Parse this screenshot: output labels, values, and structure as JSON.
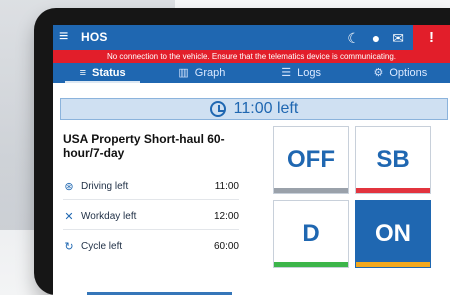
{
  "header": {
    "app_title": "HOS",
    "icons": [
      "menu-icon",
      "moon-icon",
      "user-icon",
      "mail-icon",
      "alert-icon"
    ],
    "alert_symbol": "!"
  },
  "warning": {
    "text": "No connection to the vehicle. Ensure that the telematics device is communicating."
  },
  "tabs": [
    {
      "label": "Status",
      "icon": "list-icon",
      "active": true
    },
    {
      "label": "Graph",
      "icon": "graph-icon",
      "active": false
    },
    {
      "label": "Logs",
      "icon": "logs-icon",
      "active": false
    },
    {
      "label": "Options",
      "icon": "options-icon",
      "active": false
    }
  ],
  "time_left": {
    "text": "11:00 left",
    "icon": "timer-icon"
  },
  "ruleset": {
    "title": "USA Property Short-haul 60-hour/7-day",
    "items": [
      {
        "label": "Driving left",
        "value": "11:00",
        "icon": "steering-wheel-icon"
      },
      {
        "label": "Workday left",
        "value": "12:00",
        "icon": "tools-icon"
      },
      {
        "label": "Cycle left",
        "value": "60:00",
        "icon": "cycle-icon"
      }
    ]
  },
  "status_buttons": [
    {
      "label": "OFF",
      "key": "off"
    },
    {
      "label": "SB",
      "key": "sb"
    },
    {
      "label": "D",
      "key": "d"
    },
    {
      "label": "ON",
      "key": "on"
    }
  ],
  "colors": {
    "primary": "#1f67b1",
    "danger": "#e21e2a",
    "banner_bg": "#cfe0f2",
    "off_bar": "#9aa1aa",
    "sb_bar": "#e2343e",
    "d_bar": "#3cb54a",
    "on_bar": "#f2a81e"
  }
}
